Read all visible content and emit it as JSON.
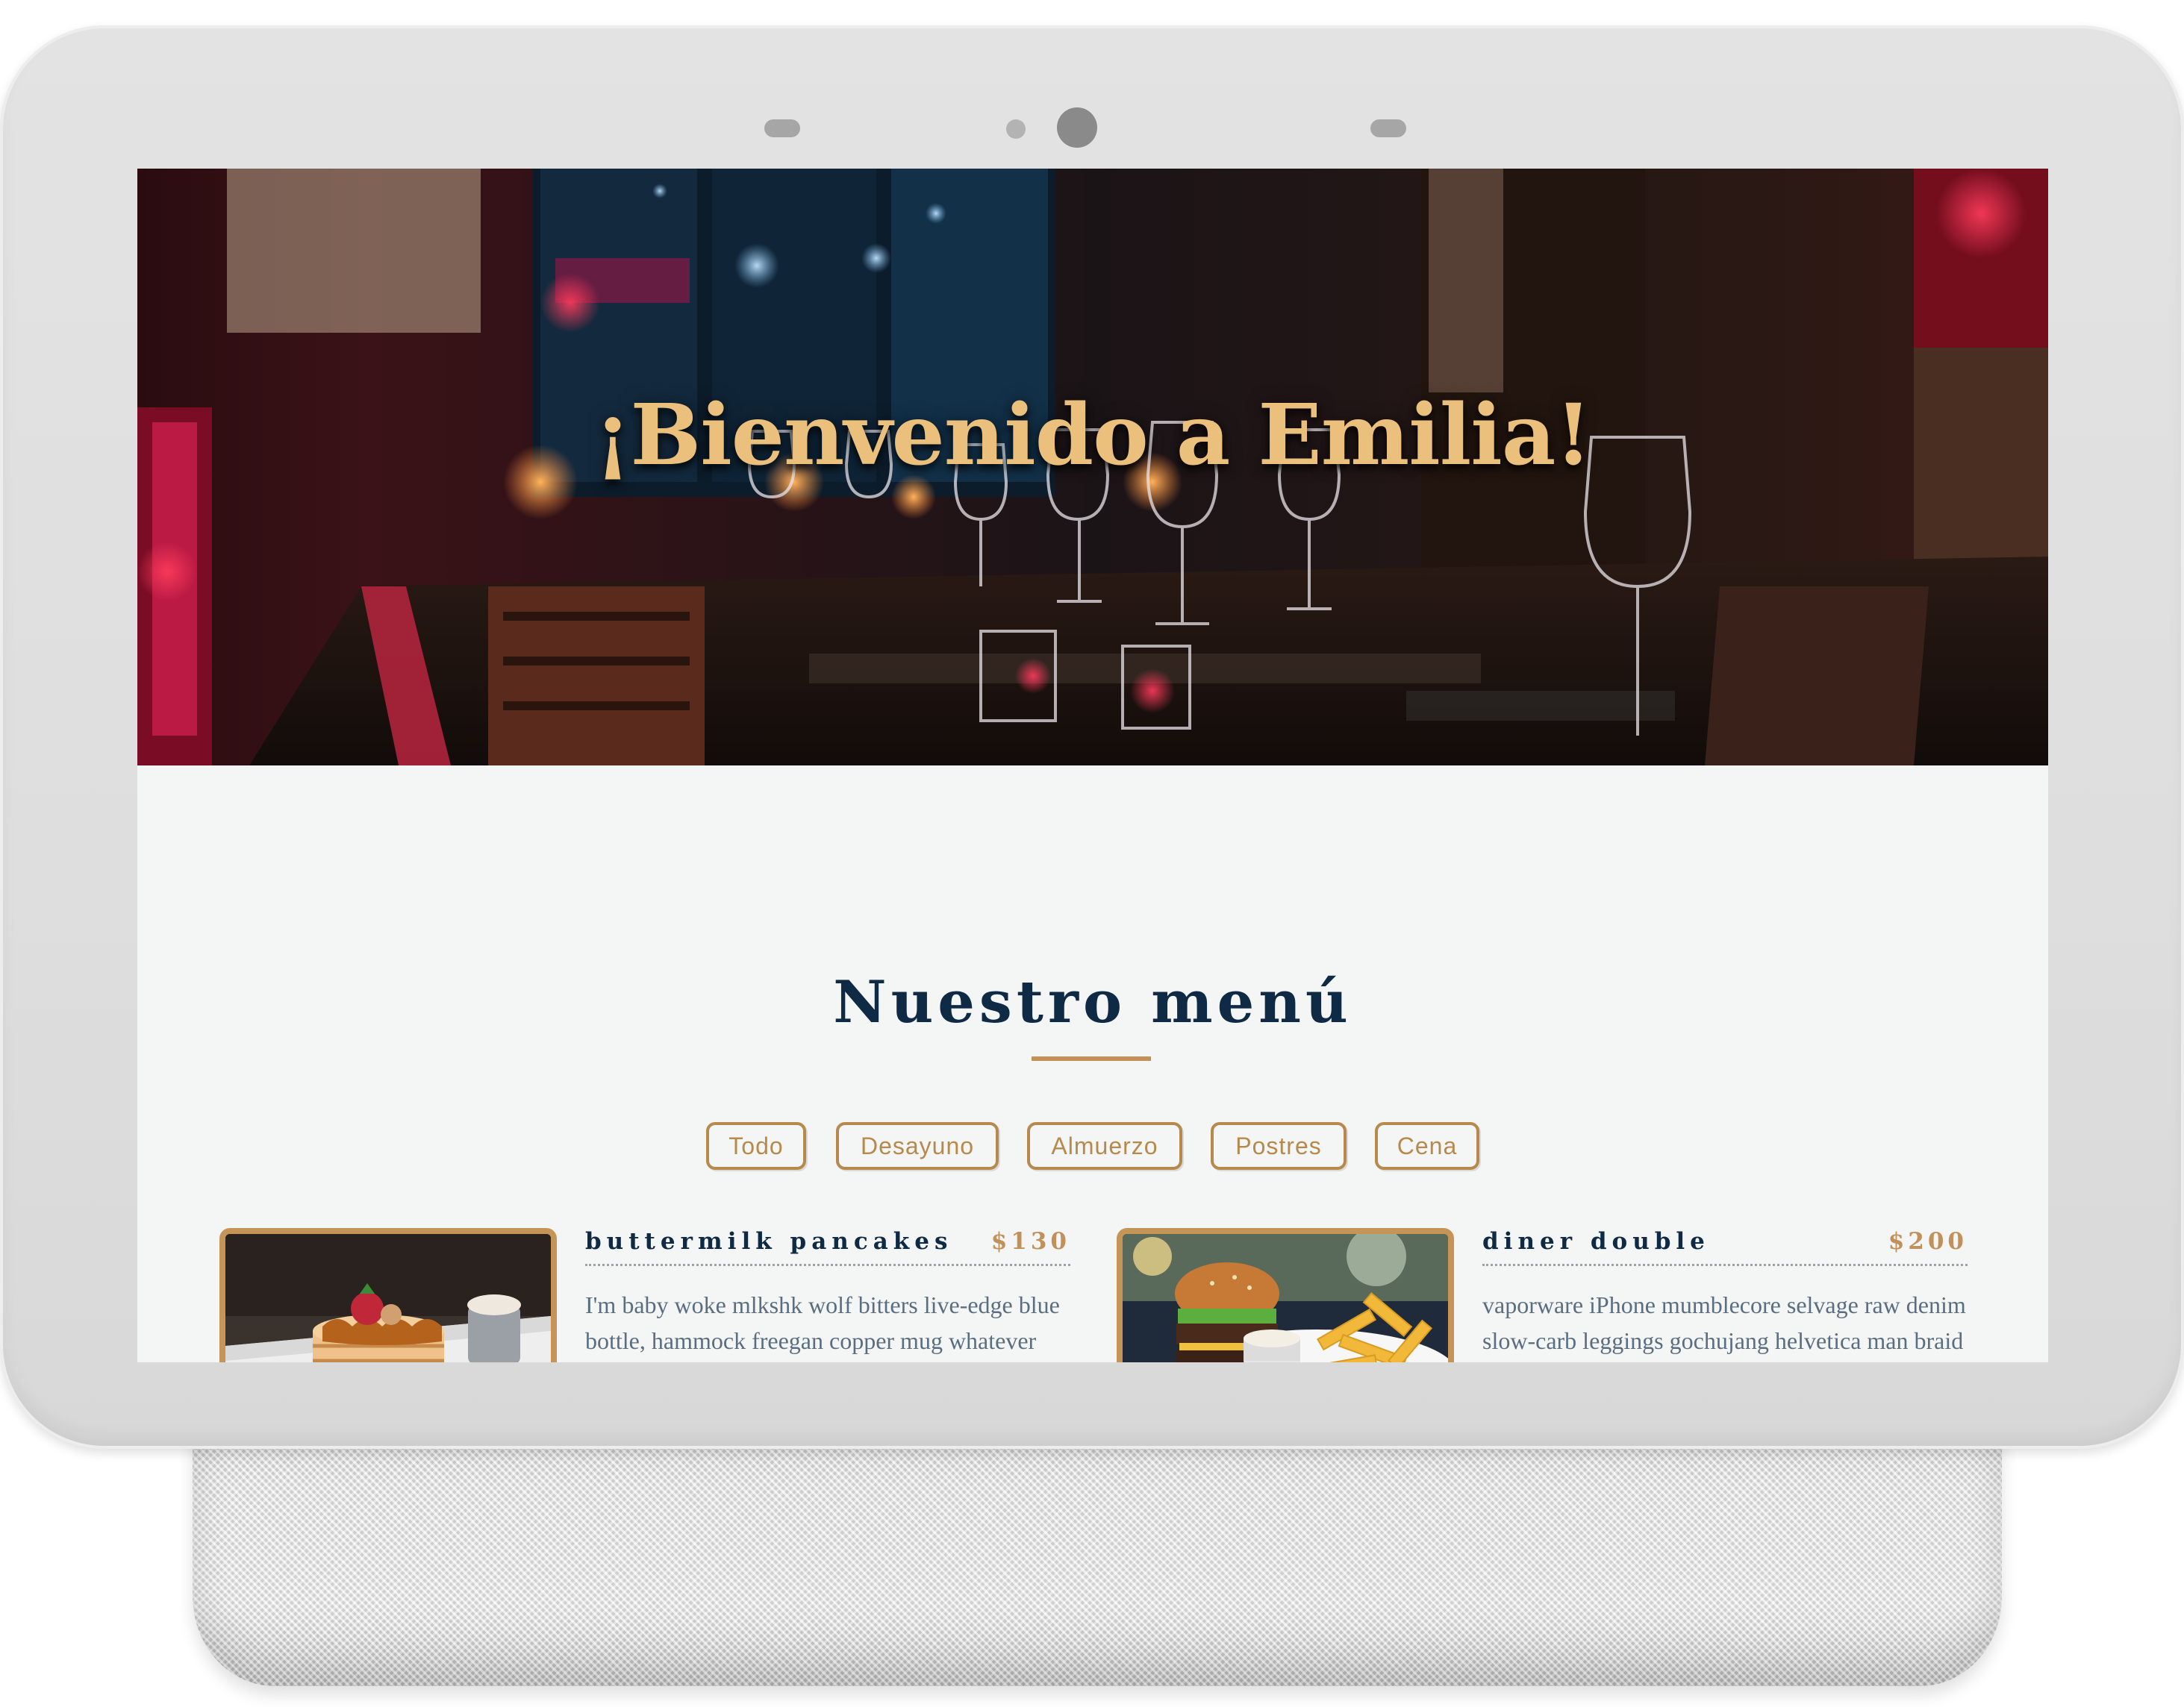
{
  "hero": {
    "title": "¡Bienvenido a Emilia!"
  },
  "menu": {
    "title": "Nuestro menú",
    "filters": [
      "Todo",
      "Desayuno",
      "Almuerzo",
      "Postres",
      "Cena"
    ],
    "items": [
      {
        "name": "buttermilk pancakes",
        "price": "$130",
        "description": "I'm baby woke mlkshk wolf bitters live-edge blue bottle, hammock freegan copper mug whatever cold-pressed",
        "image": "pancakes-photo"
      },
      {
        "name": "diner double",
        "price": "$200",
        "description": "vaporware iPhone mumblecore selvage raw denim slow-carb leggings gochujang helvetica man braid jianbing. Marfa thundercats",
        "image": "burger-photo"
      }
    ]
  },
  "colors": {
    "accent_gold": "#c2915a",
    "navy": "#0f2a45",
    "body_text": "#5a6e80",
    "screen_bg": "#f4f5f5",
    "hero_title": "#ebc07d"
  }
}
